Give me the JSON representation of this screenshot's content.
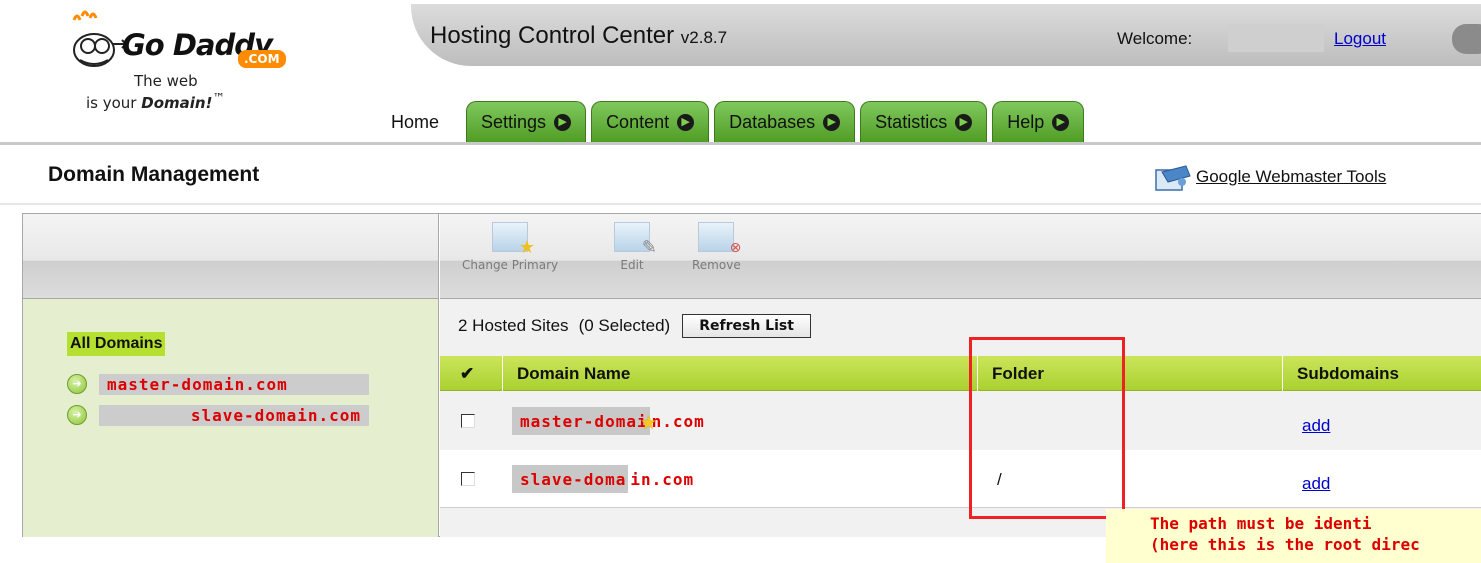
{
  "header": {
    "brand_name": "Go Daddy",
    "brand_suffix": ".COM",
    "tagline_line1": "The web",
    "tagline_line2_prefix": "is your",
    "tagline_line2_word": "Domain!",
    "tagline_tm": "™",
    "app_title": "Hosting Control Center",
    "app_version": "v2.8.7",
    "welcome_label": "Welcome:",
    "logout_label": "Logout"
  },
  "tabs": [
    {
      "label": "Home",
      "has_arrow": false
    },
    {
      "label": "Settings",
      "has_arrow": true
    },
    {
      "label": "Content",
      "has_arrow": true
    },
    {
      "label": "Databases",
      "has_arrow": true
    },
    {
      "label": "Statistics",
      "has_arrow": true
    },
    {
      "label": "Help",
      "has_arrow": true
    }
  ],
  "page": {
    "title": "Domain Management",
    "webmaster_tools_label": "Google Webmaster Tools"
  },
  "sidebar": {
    "all_domains_label": "All Domains",
    "domains": [
      "master-domain.com",
      "slave-domain.com"
    ]
  },
  "toolbar": {
    "change_primary_label": "Change Primary",
    "edit_label": "Edit",
    "remove_label": "Remove"
  },
  "list": {
    "count_text": "2  Hosted Sites",
    "selected_text": "(0 Selected)",
    "refresh_label": "Refresh List",
    "columns": {
      "check": "✔",
      "domain_name": "Domain Name",
      "folder": "Folder",
      "subdomains": "Subdomains"
    },
    "rows": [
      {
        "domain_highlight": "master-domai",
        "domain_rest": "n.com",
        "is_primary": true,
        "folder": "",
        "subdomains_link": "add"
      },
      {
        "domain_highlight": "slave-doma",
        "domain_rest": "in.com",
        "is_primary": false,
        "folder": "/",
        "subdomains_link": "add"
      }
    ]
  },
  "annotation": {
    "line1": "The path must be identi",
    "line2": "(here this is the root direc"
  },
  "colors": {
    "tab_green": "#5aa82f",
    "grid_header_green": "#b8dc3f",
    "annotation_red": "#ee2222",
    "domain_red": "#dd0000",
    "link_blue": "#0000cc"
  }
}
